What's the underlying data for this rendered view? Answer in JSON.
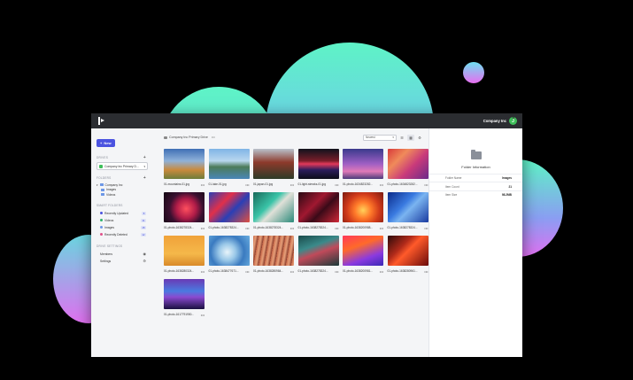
{
  "topbar": {
    "account_name": "Company Inc",
    "avatar_initial": "J"
  },
  "sidebar": {
    "new_label": "New",
    "drives_heading": "DRIVES",
    "drive_selected": "Company Inc Primary D...",
    "folders_heading": "FOLDERS",
    "tree": [
      {
        "label": "Company Inc",
        "level": 0
      },
      {
        "label": "Images",
        "level": 1
      },
      {
        "label": "Videos",
        "level": 1
      }
    ],
    "smart_heading": "SMART FOLDERS",
    "smart_folders": [
      {
        "label": "Recently Updated",
        "count": "8",
        "color": "#4b53e0"
      },
      {
        "label": "Videos",
        "count": "11",
        "color": "#2fb36b"
      },
      {
        "label": "Images",
        "count": "18",
        "color": "#6d97e6"
      },
      {
        "label": "Recently Deleted",
        "count": "12",
        "color": "#e0508a"
      }
    ],
    "drive_settings_heading": "DRIVE SETTINGS",
    "drive_settings": [
      {
        "label": "Members",
        "icon": "eye-icon"
      },
      {
        "label": "Settings",
        "icon": "gear-icon"
      }
    ]
  },
  "main": {
    "breadcrumb": "Company Inc Primary Drive",
    "breadcrumb_more": "•••",
    "sort_label": "Newest",
    "files": [
      {
        "name": "01-mountains-01.jpg",
        "bg": "linear-gradient(180deg,#3f6fb5 0%,#8fb1d9 40%,#c98a3d 70%,#6e7d3a 100%)"
      },
      {
        "name": "01-lake-01.jpg",
        "bg": "linear-gradient(180deg,#7fb4e6 0%,#b9d7ef 40%,#4c7b59 60%,#4a86b8 100%)"
      },
      {
        "name": "01-japan-01.jpg",
        "bg": "linear-gradient(180deg,#b9c2cc 0%,#8d3a2b 45%,#2d3b28 100%)"
      },
      {
        "name": "01-light-streaks-01.jpg",
        "bg": "linear-gradient(180deg,#10121c 0%,#7a1e2a 40%,#e2395a 50%,#2b1d5c 70%,#0b0d18 100%)"
      },
      {
        "name": "01-photo-1634823282...",
        "bg": "linear-gradient(180deg,#3a3a8c 0%,#9f5fc4 50%,#e07ab8 75%,#4a3a7a 100%)"
      },
      {
        "name": "01-photo-1634823282...",
        "bg": "linear-gradient(135deg,#d83a3a 0%,#f08a5a 30%,#c93a7a 60%,#6a2a8a 100%)"
      },
      {
        "name": "01-photo-1638278324...",
        "bg": "radial-gradient(circle at 55% 55%,#ff4f5e 0%,#b01c48 35%,#3a1030 60%,#120812 100%)"
      },
      {
        "name": "01-photo-1638278324...",
        "bg": "linear-gradient(135deg,#2b3fb5 0%,#e0304a 35%,#2b3fb5 60%,#e05040 100%)"
      },
      {
        "name": "01-photo-1638278324...",
        "bg": "linear-gradient(135deg,#1a6a5a 0%,#3ac4a8 40%,#e0e0d8 55%,#2a8a7a 100%)"
      },
      {
        "name": "01-photo-1638278324...",
        "bg": "linear-gradient(135deg,#2a0a14 0%,#a01830 40%,#3a0a18 60%,#d02838 100%)"
      },
      {
        "name": "01-photo-1638200988...",
        "bg": "radial-gradient(circle at 50% 60%,#ffd25a 0%,#ff7a2a 30%,#d03a1a 60%,#7a1a10 100%)"
      },
      {
        "name": "01-photo-1638278324...",
        "bg": "linear-gradient(135deg,#0a2a8a 0%,#3a7ae0 40%,#7ab4f0 55%,#1a3aa0 100%)"
      },
      {
        "name": "01-photo-1638280324...",
        "bg": "linear-gradient(180deg,#f0a23a 0%,#f5b84a 60%,#d98a2a 100%)"
      },
      {
        "name": "01-photo-1638477671...",
        "bg": "radial-gradient(circle at 45% 55%,#e8f4fa 0%,#9ac8e8 30%,#3a7ac0 60%,#6aaee0 100%)"
      },
      {
        "name": "01-photo-1638280984...",
        "bg": "repeating-linear-gradient(100deg,#c96a4a 0px,#e6a07a 3px,#8a3a2a 6px)"
      },
      {
        "name": "01-photo-1638278324...",
        "bg": "linear-gradient(160deg,#1a4a4a 0%,#3a8a8a 35%,#c04a5a 55%,#1a3a3a 100%)"
      },
      {
        "name": "01-photo-1638200981...",
        "bg": "linear-gradient(160deg,#ff3a5a 0%,#ff6a2a 35%,#8a3ae0 70%,#3a2ab5 100%)"
      },
      {
        "name": "01-photo-1638280961...",
        "bg": "linear-gradient(135deg,#2a0a0a 0%,#b02a1a 35%,#ff5a2a 50%,#6a0a0a 100%)"
      },
      {
        "name": "01-photo-1617791950...",
        "bg": "linear-gradient(180deg,#6a3ab5 0%,#4a7ae0 40%,#8a4ad0 60%,#1a1040 100%)"
      }
    ]
  },
  "info": {
    "title": "Folder Information",
    "rows": [
      {
        "label": "Folder Name",
        "value": "Images"
      },
      {
        "label": "Item Count",
        "value": "21"
      },
      {
        "label": "Item Size",
        "value": "98.2MB"
      }
    ]
  }
}
